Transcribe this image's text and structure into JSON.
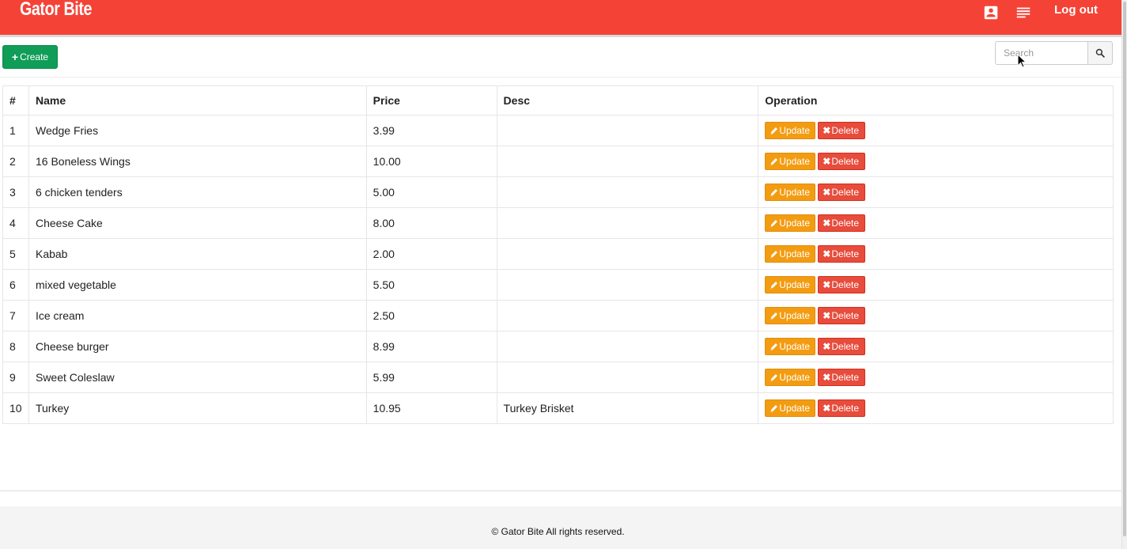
{
  "header": {
    "brand": "Gator Bite",
    "logout_label": "Log out",
    "icons": [
      "account-box-icon",
      "menu-list-icon"
    ],
    "bg_color": "#f44336"
  },
  "toolbar": {
    "create_label": "Create",
    "search_placeholder": "Search"
  },
  "table": {
    "columns": [
      "#",
      "Name",
      "Price",
      "Desc",
      "Operation"
    ],
    "update_label": "Update",
    "delete_label": "Delete",
    "rows": [
      {
        "id": "1",
        "name": "Wedge Fries",
        "price": "3.99",
        "desc": ""
      },
      {
        "id": "2",
        "name": "16 Boneless Wings",
        "price": "10.00",
        "desc": ""
      },
      {
        "id": "3",
        "name": "6 chicken tenders",
        "price": "5.00",
        "desc": ""
      },
      {
        "id": "4",
        "name": "Cheese Cake",
        "price": "8.00",
        "desc": ""
      },
      {
        "id": "5",
        "name": "Kabab",
        "price": "2.00",
        "desc": ""
      },
      {
        "id": "6",
        "name": "mixed vegetable",
        "price": "5.50",
        "desc": ""
      },
      {
        "id": "7",
        "name": "Ice cream",
        "price": "2.50",
        "desc": ""
      },
      {
        "id": "8",
        "name": "Cheese burger",
        "price": "8.99",
        "desc": ""
      },
      {
        "id": "9",
        "name": "Sweet Coleslaw",
        "price": "5.99",
        "desc": ""
      },
      {
        "id": "10",
        "name": "Turkey",
        "price": "10.95",
        "desc": "Turkey Brisket"
      }
    ]
  },
  "footer": {
    "text": "© Gator Bite All rights reserved."
  },
  "colors": {
    "create_button": "#0f9d58",
    "update_button": "#f39c12",
    "delete_button": "#e74c3c"
  }
}
